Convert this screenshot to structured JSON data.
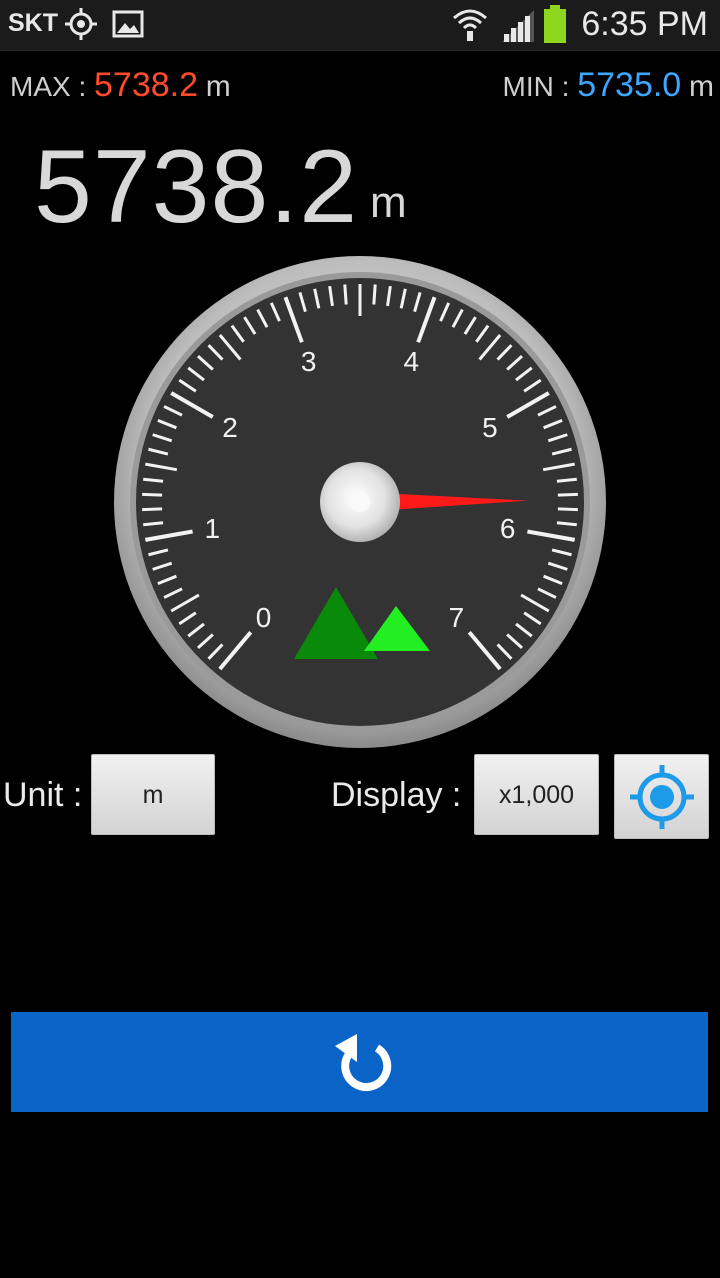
{
  "status_bar": {
    "carrier": "SKT",
    "time": "6:35 PM",
    "icons": [
      "gps-icon",
      "image-icon",
      "wifi-icon",
      "signal-icon",
      "battery-icon"
    ]
  },
  "readings": {
    "max_label": "MAX :",
    "max_value": "5738.2",
    "max_unit": "m",
    "min_label": "MIN :",
    "min_value": "5735.0",
    "min_unit": "m",
    "current_value": "5738.2",
    "current_unit": "m"
  },
  "gauge": {
    "labels": [
      "0",
      "1",
      "2",
      "3",
      "4",
      "5",
      "6",
      "7"
    ],
    "needle_value": 5.738,
    "min": 0,
    "max": 7,
    "needle_color": "#ff1a1a"
  },
  "controls": {
    "unit_label": "Unit :",
    "unit_value": "m",
    "display_label": "Display :",
    "display_value": "x1,000",
    "locate_icon": "crosshair-icon"
  },
  "reset": {
    "icon": "refresh-icon",
    "color": "#0a64c8"
  },
  "colors": {
    "max_color": "#ff4a2b",
    "min_color": "#3ea6ff"
  }
}
